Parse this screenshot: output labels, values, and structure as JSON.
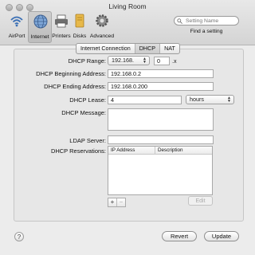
{
  "window": {
    "title": "Living Room"
  },
  "toolbar": {
    "items": [
      {
        "label": "AirPort",
        "icon": "wifi-icon"
      },
      {
        "label": "Internet",
        "icon": "globe-icon"
      },
      {
        "label": "Printers",
        "icon": "printer-icon"
      },
      {
        "label": "Disks",
        "icon": "disk-icon"
      },
      {
        "label": "Advanced",
        "icon": "gear-icon"
      }
    ],
    "selected": "Internet",
    "search": {
      "placeholder": "Setting Name",
      "caption": "Find a setting"
    }
  },
  "tabs": [
    {
      "label": "Internet Connection",
      "selected": false
    },
    {
      "label": "DHCP",
      "selected": true
    },
    {
      "label": "NAT",
      "selected": false
    }
  ],
  "form": {
    "dhcp_range": {
      "label": "DHCP Range:",
      "prefix": "192.168.",
      "octet": "0",
      "suffix": ".x"
    },
    "beginning": {
      "label": "DHCP Beginning Address:",
      "value": "192.168.0.2"
    },
    "ending": {
      "label": "DHCP Ending Address:",
      "value": "192.168.0.200"
    },
    "lease": {
      "label": "DHCP Lease:",
      "value": "4",
      "unit": "hours"
    },
    "message": {
      "label": "DHCP Message:",
      "value": ""
    },
    "ldap": {
      "label": "LDAP Server:",
      "value": ""
    },
    "reservations": {
      "label": "DHCP Reservations:",
      "columns": [
        "IP Address",
        "Description"
      ],
      "rows": [],
      "add": "+",
      "remove": "−",
      "edit": "Edit"
    }
  },
  "footer": {
    "help": "?",
    "revert": "Revert",
    "update": "Update"
  }
}
